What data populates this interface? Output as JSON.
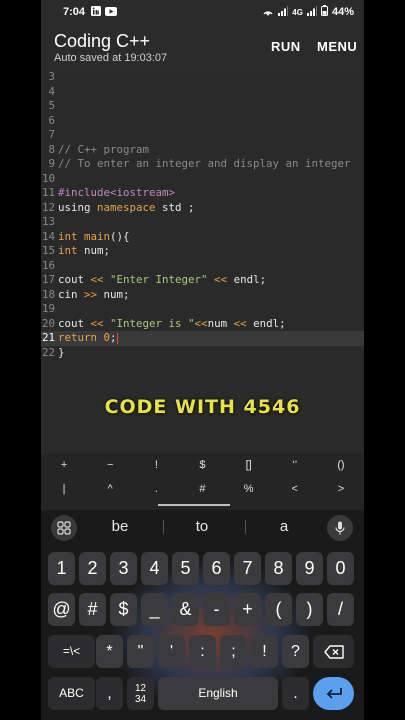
{
  "status": {
    "time": "7:04",
    "icons": [
      "linkedin-icon",
      "youtube-icon"
    ],
    "right_icons": [
      "hotspot-icon",
      "signal-icon",
      "network-4g-icon",
      "signal-icon-2",
      "battery-icon"
    ],
    "network": "4G",
    "battery": "44%"
  },
  "toolbar": {
    "title": "Coding C++",
    "subtitle": "Auto saved at 19:03:07",
    "run_label": "RUN",
    "menu_label": "MENU"
  },
  "editor": {
    "line_numbers": [
      "3",
      "4",
      "5",
      "6",
      "7",
      "8",
      "9",
      "10",
      "11",
      "12",
      "13",
      "14",
      "15",
      "16",
      "17",
      "18",
      "19",
      "20",
      "21",
      "22"
    ],
    "comment1": "// C++ program",
    "comment2": "// To enter an integer and display an integer",
    "l11_pre": "#include<iostream>",
    "l12_a": "using ",
    "l12_kw": "namespace",
    "l12_b": " std ;",
    "l14_kw": "int",
    "l14_fn": " main",
    "l14_b": "(){",
    "l15_kw": "int",
    "l15_b": " num;",
    "l17_a": "cout ",
    "l17_op1": "<<",
    "l17_str": " \"Enter Integer\" ",
    "l17_op2": "<<",
    "l17_b": " endl;",
    "l18_a": "cin ",
    "l18_op": ">>",
    "l18_b": " num;",
    "l20_a": "cout ",
    "l20_op1": "<<",
    "l20_str": " \"Integer is \"",
    "l20_op2": "<<",
    "l20_b": "num ",
    "l20_op3": "<<",
    "l20_c": " endl;",
    "l21_kw": "return",
    "l21_num": " 0",
    "l21_b": ";",
    "l22": "}",
    "watermark": "CODE WITH 4546"
  },
  "symbols": {
    "row1": [
      "+",
      "−",
      "!",
      "$",
      "[]",
      "‘’",
      "()"
    ],
    "row2": [
      "|",
      "^",
      ".",
      "#",
      "%",
      "<",
      ">"
    ]
  },
  "keyboard": {
    "suggestions": [
      "be",
      "to",
      "a"
    ],
    "row1": [
      "1",
      "2",
      "3",
      "4",
      "5",
      "6",
      "7",
      "8",
      "9",
      "0"
    ],
    "row2": [
      "@",
      "#",
      "$",
      "_",
      "&",
      "-",
      "+",
      "(",
      ")",
      "/"
    ],
    "row3_shift": "=\\<",
    "row3": [
      "*",
      "\"",
      "'",
      ":",
      ";",
      "!",
      "?"
    ],
    "abc": "ABC",
    "comma": ",",
    "numpad_label": "12\n34",
    "space_label": "English",
    "period": "."
  },
  "colors": {
    "comment": "#8a8a8a",
    "keyword": "#e8a24a",
    "string": "#a8c97a",
    "enter_key": "#5aa0ee",
    "watermark": "#e6e24a"
  }
}
